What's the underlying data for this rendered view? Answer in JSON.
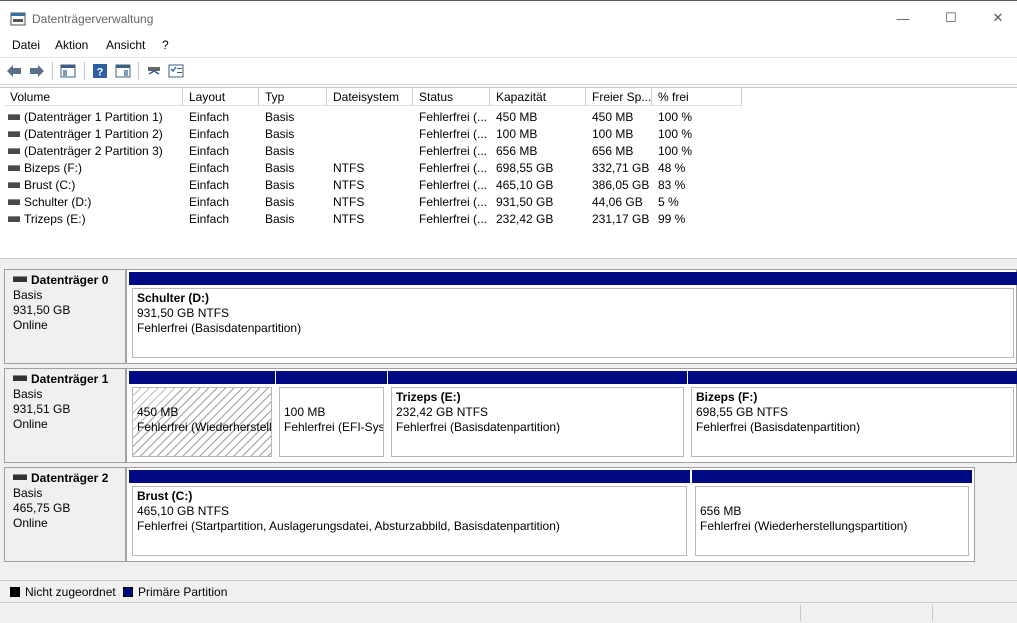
{
  "window": {
    "title": "Datenträgerverwaltung",
    "minimize": "—",
    "maximize": "☐",
    "close": "✕"
  },
  "menu": [
    "Datei",
    "Aktion",
    "Ansicht",
    "?"
  ],
  "toolbar": [
    "back-arrow-icon",
    "forward-arrow-icon",
    "console-tree-icon",
    "help-icon",
    "properties-icon",
    "connect-icon",
    "checklist-icon"
  ],
  "table": {
    "columns": [
      "Volume",
      "Layout",
      "Typ",
      "Dateisystem",
      "Status",
      "Kapazität",
      "Freier Sp...",
      "% frei"
    ],
    "rows": [
      [
        "(Datenträger 1 Partition 1)",
        "Einfach",
        "Basis",
        "",
        "Fehlerfrei (...",
        "450 MB",
        "450 MB",
        "100 %"
      ],
      [
        "(Datenträger 1 Partition 2)",
        "Einfach",
        "Basis",
        "",
        "Fehlerfrei (...",
        "100 MB",
        "100 MB",
        "100 %"
      ],
      [
        "(Datenträger 2 Partition 3)",
        "Einfach",
        "Basis",
        "",
        "Fehlerfrei (...",
        "656 MB",
        "656 MB",
        "100 %"
      ],
      [
        "Bizeps (F:)",
        "Einfach",
        "Basis",
        "NTFS",
        "Fehlerfrei (...",
        "698,55 GB",
        "332,71 GB",
        "48 %"
      ],
      [
        "Brust (C:)",
        "Einfach",
        "Basis",
        "NTFS",
        "Fehlerfrei (...",
        "465,10 GB",
        "386,05 GB",
        "83 %"
      ],
      [
        "Schulter (D:)",
        "Einfach",
        "Basis",
        "NTFS",
        "Fehlerfrei (...",
        "931,50 GB",
        "44,06 GB",
        "5 %"
      ],
      [
        "Trizeps (E:)",
        "Einfach",
        "Basis",
        "NTFS",
        "Fehlerfrei (...",
        "232,42 GB",
        "231,17 GB",
        "99 %"
      ]
    ]
  },
  "disks": [
    {
      "title": "Datenträger 0",
      "type": "Basis",
      "size": "931,50 GB",
      "state": "Online",
      "partitions": [
        {
          "name": "Schulter  (D:)",
          "size": "931,50 GB NTFS",
          "status": "Fehlerfrei (Basisdatenpartition)",
          "hatched": false
        }
      ]
    },
    {
      "title": "Datenträger 1",
      "type": "Basis",
      "size": "931,51 GB",
      "state": "Online",
      "partitions": [
        {
          "name": "",
          "size": "450 MB",
          "status": "Fehlerfrei (Wiederherstell",
          "hatched": true
        },
        {
          "name": "",
          "size": "100 MB",
          "status": "Fehlerfrei (EFI-Syst",
          "hatched": false
        },
        {
          "name": "Trizeps  (E:)",
          "size": "232,42 GB NTFS",
          "status": "Fehlerfrei (Basisdatenpartition)",
          "hatched": false
        },
        {
          "name": "Bizeps  (F:)",
          "size": "698,55 GB NTFS",
          "status": "Fehlerfrei (Basisdatenpartition)",
          "hatched": false
        }
      ]
    },
    {
      "title": "Datenträger 2",
      "type": "Basis",
      "size": "465,75 GB",
      "state": "Online",
      "partitions": [
        {
          "name": "Brust  (C:)",
          "size": "465,10 GB NTFS",
          "status": "Fehlerfrei (Startpartition, Auslagerungsdatei, Absturzabbild, Basisdatenpartition)",
          "hatched": false
        },
        {
          "name": "",
          "size": "656 MB",
          "status": "Fehlerfrei (Wiederherstellungspartition)",
          "hatched": false
        }
      ]
    }
  ],
  "legend": [
    {
      "label": "Nicht zugeordnet",
      "color": "#000000"
    },
    {
      "label": "Primäre Partition",
      "color": "#000a82"
    }
  ],
  "colors": {
    "partition_bar": "#000a82",
    "background": "#f0f0f0"
  }
}
